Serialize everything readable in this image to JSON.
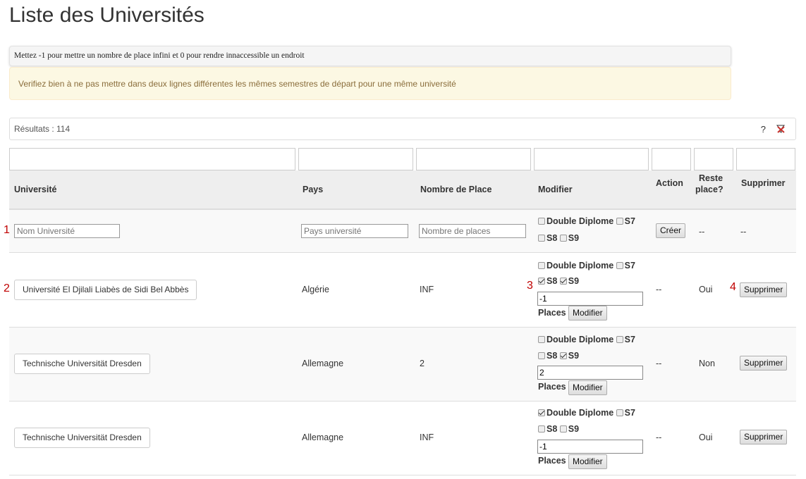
{
  "page": {
    "title": "Liste des Universités",
    "info": "Mettez -1 pour mettre un nombre de place infini et 0 pour rendre innaccessible un endroit",
    "warning": "Verifiez bien à ne pas mettre dans deux lignes différentes les mêmes semestres de départ pour une même université"
  },
  "results": {
    "label": "Résultats : 114",
    "help": "?"
  },
  "table": {
    "headers": {
      "universite": "Université",
      "pays": "Pays",
      "nombre": "Nombre de Place",
      "modifier": "Modifier",
      "action": "Action",
      "reste_1": "Reste",
      "reste_2": "place?",
      "supprimer": "Supprimer"
    },
    "checkbox_labels": {
      "dd": "Double Diplome",
      "s7": "S7",
      "s8": "S8",
      "s9": "S9",
      "places": "Places"
    },
    "new_row": {
      "marker": "1",
      "nom_placeholder": "Nom Université",
      "pays_placeholder": "Pays université",
      "places_placeholder": "Nombre de places",
      "create_label": "Créer",
      "action_dash": "--",
      "reste_dash": "--",
      "supprimer_dash": "--"
    },
    "rows": [
      {
        "marker_left": "2",
        "marker_mid": "3",
        "marker_right": "4",
        "university": "Université El Djilali Liabès de Sidi Bel Abbès",
        "country": "Algérie",
        "places": "INF",
        "places_value": "-1",
        "dd": false,
        "s7": false,
        "s8": true,
        "s9": true,
        "action": "--",
        "reste": "Oui",
        "modify_label": "Modifier",
        "delete_label": "Supprimer"
      },
      {
        "university": "Technische Universität Dresden",
        "country": "Allemagne",
        "places": "2",
        "places_value": "2",
        "dd": false,
        "s7": false,
        "s8": false,
        "s9": true,
        "action": "--",
        "reste": "Non",
        "modify_label": "Modifier",
        "delete_label": "Supprimer"
      },
      {
        "university": "Technische Universität Dresden",
        "country": "Allemagne",
        "places": "INF",
        "places_value": "-1",
        "dd": true,
        "s7": false,
        "s8": false,
        "s9": false,
        "action": "--",
        "reste": "Oui",
        "modify_label": "Modifier",
        "delete_label": "Supprimer"
      }
    ]
  },
  "colors": {
    "marker": "#c00000",
    "warning_bg": "#fcf8e3",
    "warning_text": "#8a6d3b",
    "clear_icon": "#c9302c"
  }
}
